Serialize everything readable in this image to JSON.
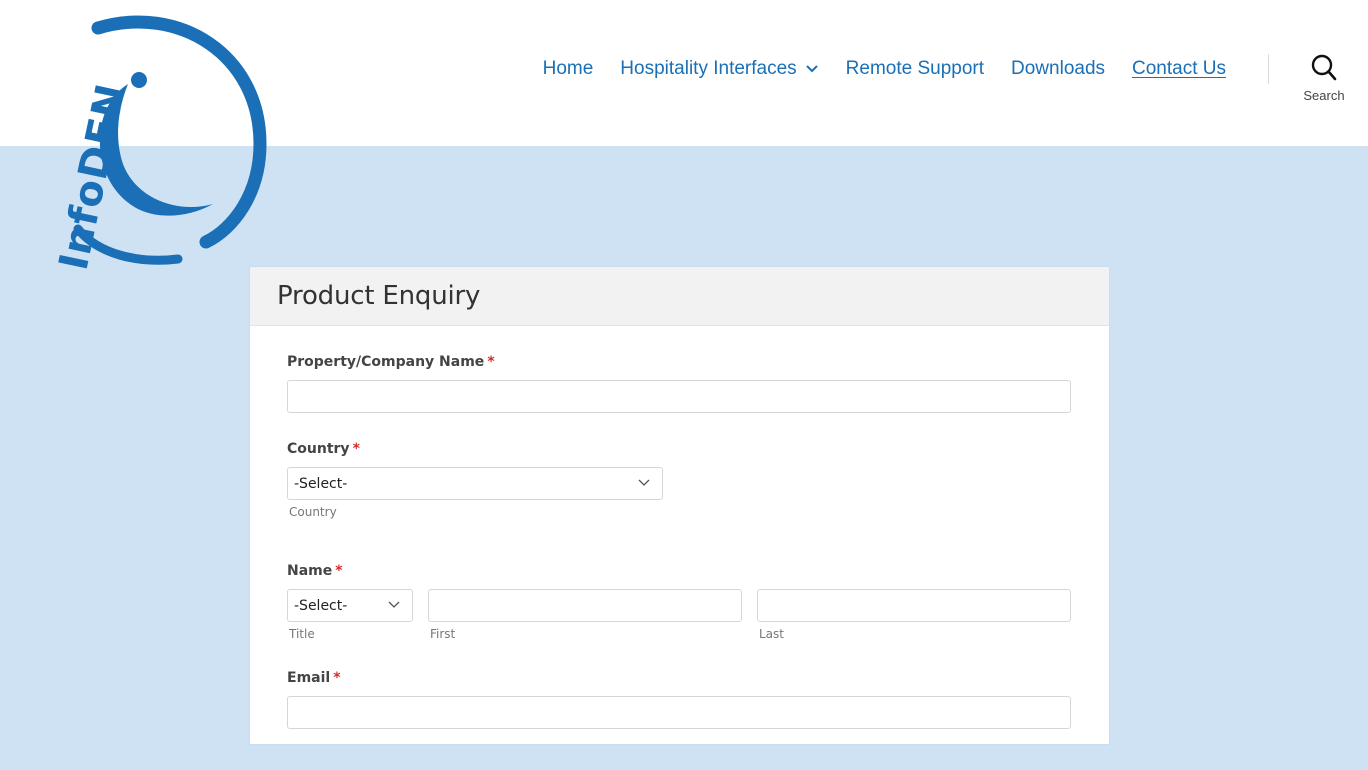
{
  "header": {
    "logo_text": "InfoDEN",
    "nav": [
      {
        "label": "Home",
        "has_dropdown": false,
        "active": false
      },
      {
        "label": "Hospitality Interfaces",
        "has_dropdown": true,
        "active": false
      },
      {
        "label": "Remote Support",
        "has_dropdown": false,
        "active": false
      },
      {
        "label": "Downloads",
        "has_dropdown": false,
        "active": false
      },
      {
        "label": "Contact Us",
        "has_dropdown": false,
        "active": true
      }
    ],
    "search_label": "Search"
  },
  "form": {
    "title": "Product Enquiry",
    "company": {
      "label": "Property/Company Name",
      "required": "*",
      "value": ""
    },
    "country": {
      "label": "Country",
      "required": "*",
      "selected": "-Select-",
      "sublabel": "Country"
    },
    "name": {
      "label": "Name",
      "required": "*",
      "title_selected": "-Select-",
      "title_sublabel": "Title",
      "first_value": "",
      "first_sublabel": "First",
      "last_value": "",
      "last_sublabel": "Last"
    },
    "email": {
      "label": "Email",
      "required": "*",
      "value": ""
    }
  },
  "colors": {
    "brand_blue": "#1a6fb7",
    "page_background": "#cfe2f3",
    "required": "#d62b2b"
  }
}
